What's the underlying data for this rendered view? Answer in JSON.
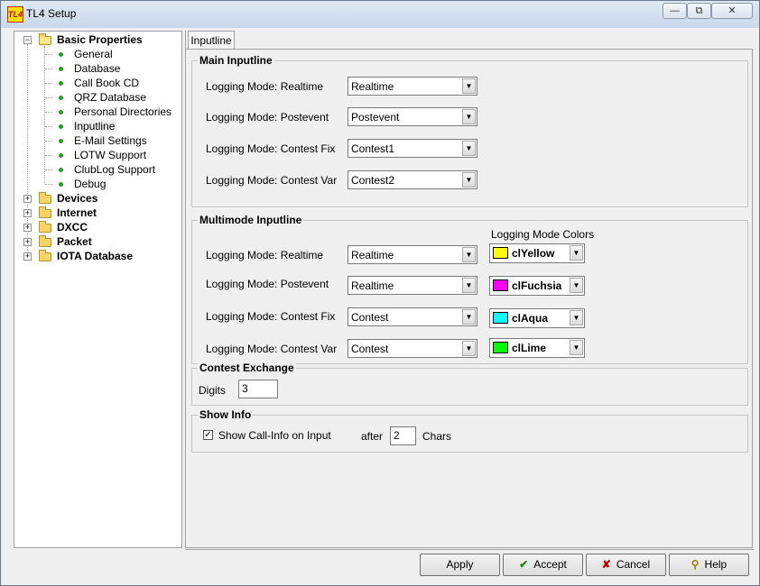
{
  "window": {
    "title": "TL4 Setup",
    "app_icon_text": "TL4"
  },
  "tree": {
    "root": {
      "label": "Basic Properties"
    },
    "children": [
      {
        "label": "General"
      },
      {
        "label": "Database"
      },
      {
        "label": "Call Book CD"
      },
      {
        "label": "QRZ Database"
      },
      {
        "label": "Personal Directories"
      },
      {
        "label": "Inputline"
      },
      {
        "label": "E-Mail Settings"
      },
      {
        "label": "LOTW Support"
      },
      {
        "label": "ClubLog Support"
      },
      {
        "label": "Debug"
      }
    ],
    "folders": [
      {
        "label": "Devices"
      },
      {
        "label": "Internet"
      },
      {
        "label": "DXCC"
      },
      {
        "label": "Packet"
      },
      {
        "label": "IOTA Database"
      }
    ]
  },
  "tab": {
    "label": "Inputline"
  },
  "main_inputline": {
    "title": "Main Inputline",
    "rows": [
      {
        "label": "Logging Mode: Realtime",
        "value": "Realtime"
      },
      {
        "label": "Logging Mode: Postevent",
        "value": "Postevent"
      },
      {
        "label": "Logging Mode: Contest Fix",
        "value": "Contest1"
      },
      {
        "label": "Logging Mode: Contest Var",
        "value": "Contest2"
      }
    ]
  },
  "multimode_inputline": {
    "title": "Multimode Inputline",
    "colors_header": "Logging Mode Colors",
    "rows": [
      {
        "label": "Logging Mode: Realtime",
        "value": "Realtime",
        "color_name": "clYellow",
        "color": "#ffff00"
      },
      {
        "label": "Logging Mode: Postevent",
        "value": "Realtime",
        "color_name": "clFuchsia",
        "color": "#ff00ff"
      },
      {
        "label": "Logging Mode: Contest Fix",
        "value": "Contest",
        "color_name": "clAqua",
        "color": "#00ffff"
      },
      {
        "label": "Logging Mode: Contest Var",
        "value": "Contest",
        "color_name": "clLime",
        "color": "#00ff00"
      }
    ]
  },
  "contest_exchange": {
    "title": "Contest Exchange",
    "digits_label": "Digits",
    "digits_value": "3"
  },
  "show_info": {
    "title": "Show Info",
    "checkbox_label": "Show Call-Info on Input",
    "checked": true,
    "after_label": "after",
    "chars_value": "2",
    "chars_label": "Chars"
  },
  "buttons": {
    "apply": "Apply",
    "accept": "Accept",
    "cancel": "Cancel",
    "help": "Help"
  }
}
